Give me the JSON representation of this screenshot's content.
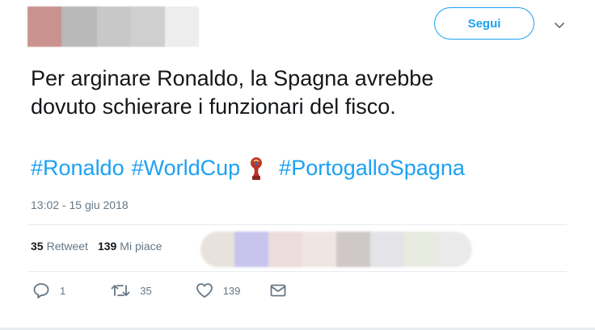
{
  "header": {
    "follow_label": "Segui"
  },
  "tweet": {
    "text_line1": "Per arginare Ronaldo, la Spagna avrebbe",
    "text_line2": "dovuto schierare i funzionari del fisco.",
    "hashtags": [
      "#Ronaldo",
      "#WorldCup",
      "#PortogalloSpagna"
    ],
    "timestamp": "13:02 - 15 giu 2018"
  },
  "stats": {
    "retweet_count": "35",
    "retweet_label": "Retweet",
    "like_count": "139",
    "like_label": "Mi piace"
  },
  "actions": {
    "reply_count": "1",
    "retweet_count": "35",
    "like_count": "139"
  },
  "icons": {
    "reply": "reply-icon",
    "retweet": "retweet-icon",
    "like": "heart-icon",
    "dm": "envelope-icon",
    "caret": "chevron-down-icon",
    "emoji": "world-cup-trophy-icon"
  },
  "colors": {
    "accent": "#1da1f2",
    "text": "#14171a",
    "muted": "#657786",
    "divider": "#e6ecf0"
  }
}
